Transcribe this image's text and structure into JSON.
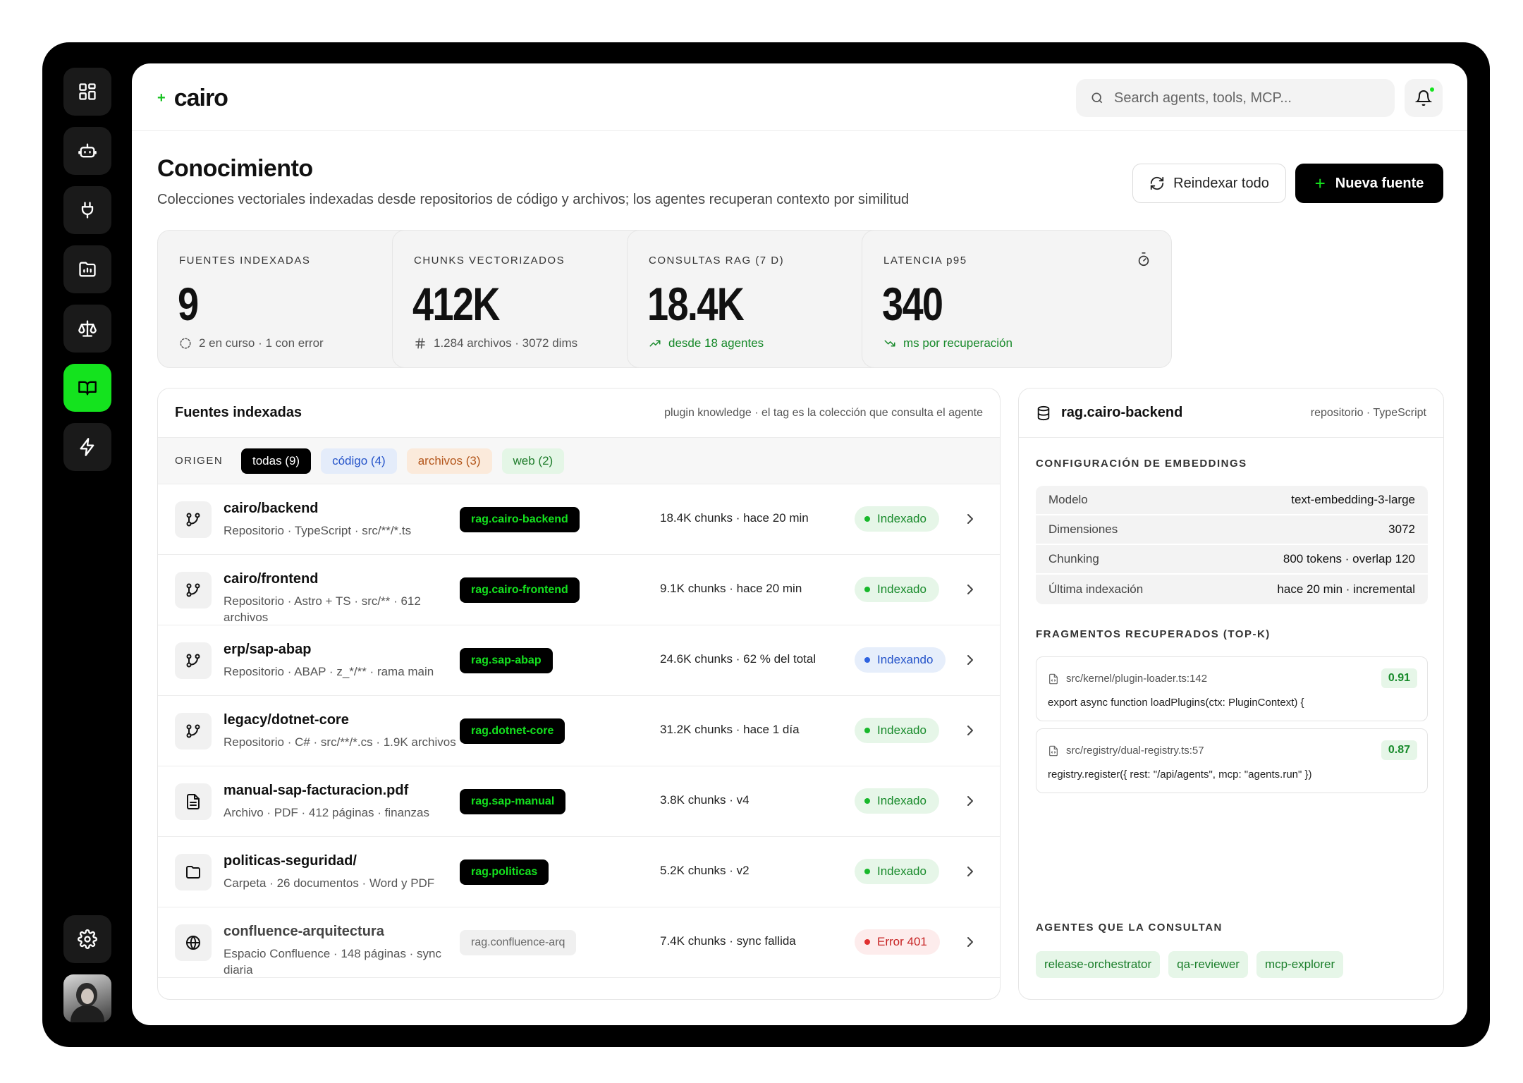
{
  "app": {
    "logo_plus": "+",
    "name": "cairo"
  },
  "rail": {
    "items": [
      {
        "icon": "dashboard-icon"
      },
      {
        "icon": "robot-icon"
      },
      {
        "icon": "plug-icon"
      },
      {
        "icon": "analytics-folder-icon"
      },
      {
        "icon": "scale-icon"
      },
      {
        "icon": "book-icon",
        "active": true
      },
      {
        "icon": "bolt-icon"
      }
    ],
    "settings_icon": "gear-icon"
  },
  "search": {
    "placeholder": "Search agents, tools, MCP..."
  },
  "header": {
    "title": "Conocimiento",
    "subtitle": "Colecciones vectoriales indexadas desde repositorios de código y archivos; los agentes recuperan contexto por similitud",
    "reindex_label": "Reindexar todo",
    "new_label": "Nueva fuente",
    "new_plus": "+"
  },
  "stats": [
    {
      "label": "FUENTES INDEXADAS",
      "value": "9",
      "foot": "2 en curso · 1 con error",
      "icon": "database-icon"
    },
    {
      "label": "CHUNKS VECTORIZADOS",
      "value": "412K",
      "foot": "1.284 archivos · 3072 dims",
      "icon": "layers-icon"
    },
    {
      "label": "CONSULTAS RAG (7 D)",
      "value": "18.4K",
      "foot": "desde 18 agentes",
      "icon": "search-icon"
    },
    {
      "label": "LATENCIA p95",
      "value": "340",
      "foot": "ms por recuperación",
      "icon": "timer-icon"
    }
  ],
  "sources": {
    "title": "Fuentes indexadas",
    "subtitle": "plugin knowledge · el tag es la colección que consulta el agente",
    "origin_label": "ORIGEN",
    "filters": [
      "todas (9)",
      "código (4)",
      "archivos (3)",
      "web (2)"
    ],
    "rows": [
      {
        "name": "cairo/backend",
        "meta": "Repositorio · TypeScript · src/**/*.ts",
        "tag": "rag.cairo-backend",
        "chunks": "18.4K chunks · hace 20 min",
        "status": "Indexado"
      },
      {
        "name": "cairo/frontend",
        "meta": "Repositorio · Astro + TS · src/** · 612 archivos",
        "tag": "rag.cairo-frontend",
        "chunks": "9.1K chunks · hace 20 min",
        "status": "Indexado"
      },
      {
        "name": "erp/sap-abap",
        "meta": "Repositorio · ABAP · z_*/** · rama main",
        "tag": "rag.sap-abap",
        "chunks": "24.6K chunks · 62 % del total",
        "status": "Indexando"
      },
      {
        "name": "legacy/dotnet-core",
        "meta": "Repositorio · C# · src/**/*.cs · 1.9K archivos",
        "tag": "rag.dotnet-core",
        "chunks": "31.2K chunks · hace 1 día",
        "status": "Indexado"
      },
      {
        "name": "manual-sap-facturacion.pdf",
        "meta": "Archivo · PDF · 412 páginas · finanzas",
        "tag": "rag.sap-manual",
        "chunks": "3.8K chunks · v4",
        "status": "Indexado"
      },
      {
        "name": "politicas-seguridad/",
        "meta": "Carpeta · 26 documentos · Word y PDF",
        "tag": "rag.politicas",
        "chunks": "5.2K chunks · v2",
        "status": "Indexado"
      },
      {
        "name": "confluence-arquitectura",
        "meta": "Espacio Confluence · 148 páginas · sync diaria",
        "tag": "rag.confluence-arq",
        "chunks": "7.4K chunks · sync fallida",
        "status": "Error 401"
      }
    ]
  },
  "detail": {
    "title": "rag.cairo-backend",
    "subtitle": "repositorio · TypeScript",
    "config_label": "CONFIGURACIÓN DE EMBEDDINGS",
    "config": [
      {
        "k": "Modelo",
        "v": "text-embedding-3-large"
      },
      {
        "k": "Dimensiones",
        "v": "3072"
      },
      {
        "k": "Chunking",
        "v": "800 tokens · overlap 120"
      },
      {
        "k": "Última indexación",
        "v": "hace 20 min · incremental"
      }
    ],
    "fragments_label": "FRAGMENTOS RECUPERADOS (TOP-K)",
    "fragments": [
      {
        "path": "src/kernel/plugin-loader.ts:142",
        "score": "0.91",
        "code": "export async function loadPlugins(ctx: PluginContext) {"
      },
      {
        "path": "src/registry/dual-registry.ts:57",
        "score": "0.87",
        "code": "registry.register({ rest: \"/api/agents\", mcp: \"agents.run\" })"
      }
    ],
    "agents_label": "AGENTES QUE LA CONSULTAN",
    "agents": [
      "release-orchestrator",
      "qa-reviewer",
      "mcp-explorer"
    ]
  },
  "colors": {
    "accent": "#14e31e",
    "ok": "#178a2a",
    "running": "#2453c9",
    "error": "#c72424"
  }
}
